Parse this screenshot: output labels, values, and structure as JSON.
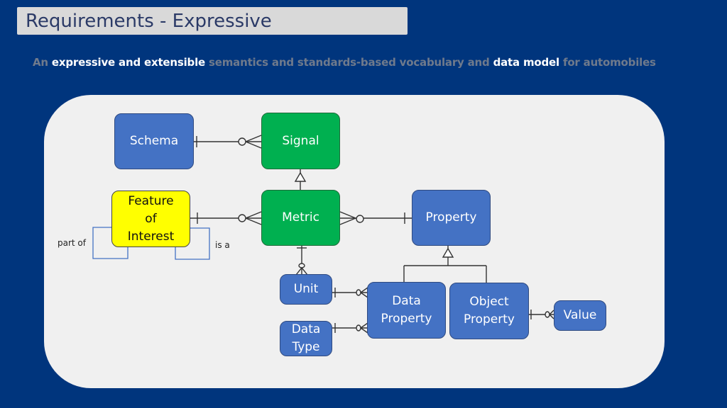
{
  "slide": {
    "title": "Requirements - Expressive",
    "subtitle": [
      {
        "text": "An ",
        "emphasis": false
      },
      {
        "text": "expressive and extensible",
        "emphasis": true
      },
      {
        "text": " semantics and standards-based vocabulary and ",
        "emphasis": false
      },
      {
        "text": "data model",
        "emphasis": true
      },
      {
        "text": " for automobiles",
        "emphasis": false
      }
    ]
  },
  "colors": {
    "background": "#00357d",
    "panel": "#f0f0f0",
    "entity_blue": "#4472c4",
    "entity_green": "#00b050",
    "entity_yellow": "#ffff00"
  },
  "diagram": {
    "entities": {
      "schema": "Schema",
      "signal": "Signal",
      "feature_of_interest": "Feature of Interest",
      "metric": "Metric",
      "property": "Property",
      "unit": "Unit",
      "data_property": "Data Property",
      "object_property": "Object Property",
      "value": "Value",
      "data_type": "Data Type"
    },
    "self_relation_labels": {
      "part_of": "part of",
      "is_a": "is a"
    },
    "relationships": [
      {
        "from": "Schema",
        "to": "Signal",
        "from_card": "one",
        "to_card": "zero-or-many"
      },
      {
        "from": "Metric",
        "to": "Signal",
        "type": "inheritance"
      },
      {
        "from": "Feature of Interest",
        "to": "Metric",
        "from_card": "one",
        "to_card": "zero-or-many"
      },
      {
        "from": "Property",
        "to": "Metric",
        "from_card": "one",
        "to_card": "zero-or-many"
      },
      {
        "from": "Metric",
        "to": "Unit",
        "from_card": "one",
        "to_card": "zero-or-many"
      },
      {
        "from": "Data Property",
        "to": "Property",
        "type": "inheritance"
      },
      {
        "from": "Object Property",
        "to": "Property",
        "type": "inheritance"
      },
      {
        "from": "Unit",
        "to": "Data Property",
        "from_card": "one",
        "to_card": "zero-or-many"
      },
      {
        "from": "Data Type",
        "to": "Data Property",
        "from_card": "one",
        "to_card": "zero-or-many"
      },
      {
        "from": "Object Property",
        "to": "Value",
        "from_card": "one",
        "to_card": "zero-or-many"
      },
      {
        "from": "Feature of Interest",
        "to": "Feature of Interest",
        "label": "part of"
      },
      {
        "from": "Feature of Interest",
        "to": "Feature of Interest",
        "label": "is a"
      }
    ]
  }
}
